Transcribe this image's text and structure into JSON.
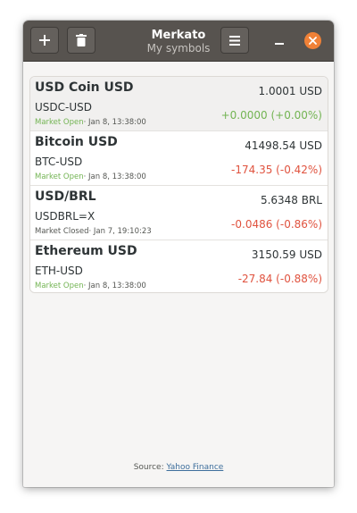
{
  "app": {
    "title": "Merkato",
    "subtitle": "My symbols"
  },
  "header": {
    "add_icon": "plus-icon",
    "delete_icon": "trash-icon",
    "menu_icon": "hamburger-menu-icon",
    "minimize_icon": "minimize-icon",
    "close_icon": "close-icon"
  },
  "symbols": [
    {
      "name": "USD Coin USD",
      "code": "USDC-USD",
      "market_state": "Market Open",
      "timestamp": "· Jan 8, 13:38:00",
      "price": "1.0001  USD",
      "change": "+0.0000 (+0.00%)",
      "change_color": "#73b453",
      "state_class": "st-open",
      "selected": true
    },
    {
      "name": "Bitcoin USD",
      "code": "BTC-USD",
      "market_state": "Market Open",
      "timestamp": "· Jan 8, 13:38:00",
      "price": "41498.54  USD",
      "change": "-174.35 (-0.42%)",
      "change_color": "#e0533f",
      "state_class": "st-open",
      "selected": false
    },
    {
      "name": "USD/BRL",
      "code": "USDBRL=X",
      "market_state": "Market Closed",
      "timestamp": "· Jan 7, 19:10:23",
      "price": "5.6348  BRL",
      "change": "-0.0486 (-0.86%)",
      "change_color": "#e0533f",
      "state_class": "st-closed",
      "selected": false
    },
    {
      "name": "Ethereum USD",
      "code": "ETH-USD",
      "market_state": "Market Open",
      "timestamp": "· Jan 8, 13:38:00",
      "price": "3150.59  USD",
      "change": "-27.84 (-0.88%)",
      "change_color": "#e0533f",
      "state_class": "st-open",
      "selected": false
    }
  ],
  "footer": {
    "source_label": "Source:",
    "source_link": "Yahoo Finance"
  },
  "colors": {
    "titlebar": "#57534f",
    "accent_close": "#f08137",
    "positive": "#73b453",
    "negative": "#e0533f"
  }
}
